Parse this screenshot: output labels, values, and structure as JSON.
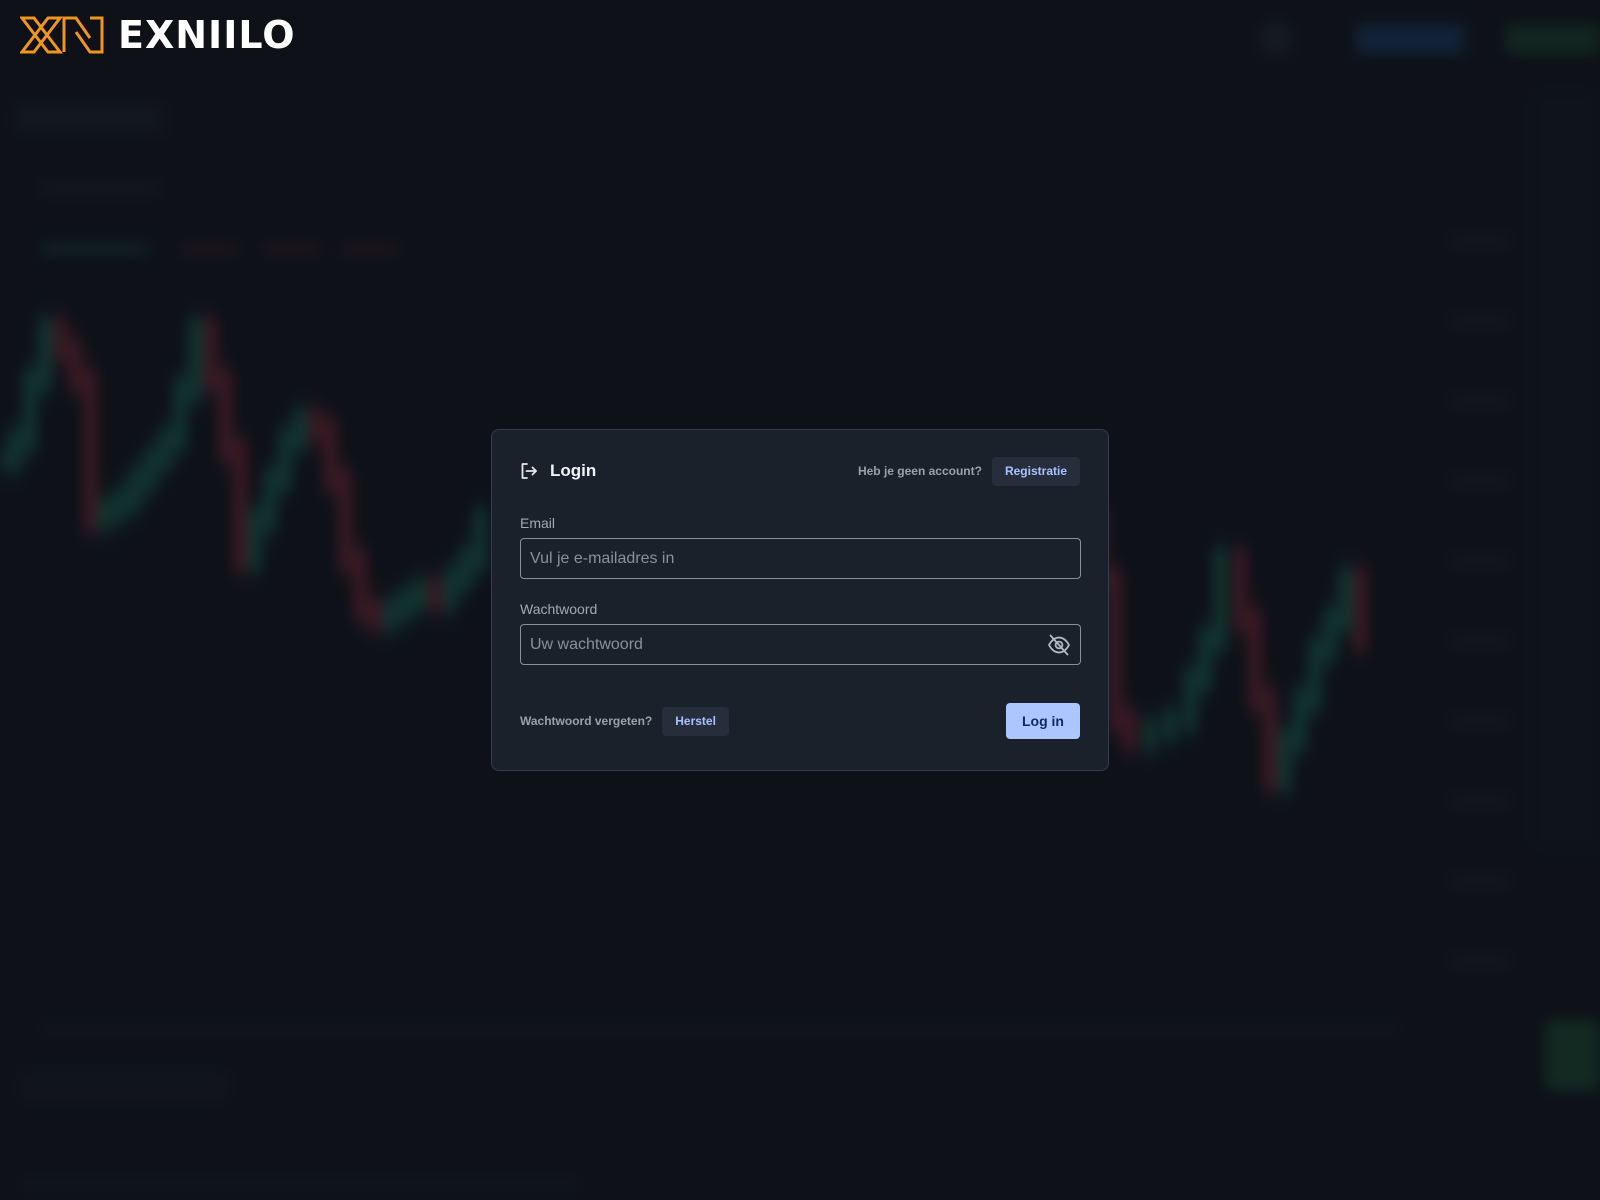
{
  "brand": {
    "name": "EXNIILO",
    "accent": "#f0961e"
  },
  "login": {
    "title": "Login",
    "no_account_text": "Heb je geen account?",
    "register_label": "Registratie",
    "email": {
      "label": "Email",
      "placeholder": "Vul je e-mailadres in",
      "value": ""
    },
    "password": {
      "label": "Wachtwoord",
      "placeholder": "Uw wachtwoord",
      "value": "",
      "toggle_icon": "eye-off-icon"
    },
    "forgot_text": "Wachtwoord vergeten?",
    "recover_label": "Herstel",
    "submit_label": "Log in"
  },
  "colors": {
    "background": "#11151d",
    "dialog": "#1b212b",
    "primary_button": "#adc6ff",
    "link_text": "#a9c2ff",
    "candle_up": "#1f9e7a",
    "candle_down": "#c0374a"
  }
}
